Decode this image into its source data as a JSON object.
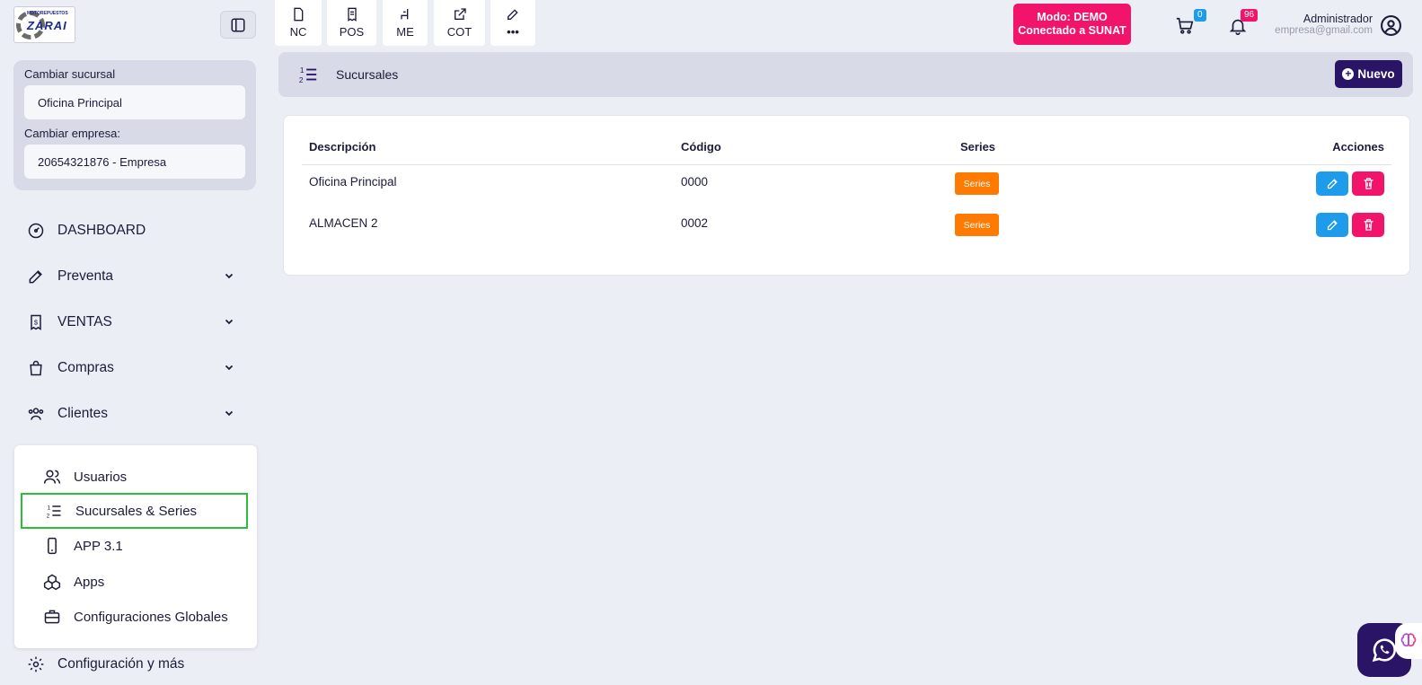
{
  "logo": {
    "top_text": "MOTOREPUESTOS",
    "brand": "ZARAI"
  },
  "branch_card": {
    "branch_label": "Cambiar sucursal",
    "branch_value": "Oficina Principal",
    "company_label": "Cambiar empresa:",
    "company_value": "20654321876 - Empresa"
  },
  "sidebar": {
    "items": [
      {
        "label": "DASHBOARD",
        "icon": "gauge-icon",
        "has_children": false
      },
      {
        "label": "Preventa",
        "icon": "edit-icon",
        "has_children": true
      },
      {
        "label": "VENTAS",
        "icon": "receipt-icon",
        "has_children": true
      },
      {
        "label": "Compras",
        "icon": "shopping-bag-icon",
        "has_children": true
      },
      {
        "label": "Clientes",
        "icon": "users-icon",
        "has_children": true
      }
    ],
    "submenu": [
      {
        "label": "Usuarios",
        "icon": "users-icon"
      },
      {
        "label": "Sucursales & Series",
        "icon": "ordered-list-icon",
        "active": true
      },
      {
        "label": "APP 3.1",
        "icon": "smartphone-icon"
      },
      {
        "label": "Apps",
        "icon": "boxes-icon"
      },
      {
        "label": "Configuraciones Globales",
        "icon": "briefcase-icon"
      }
    ],
    "footer": {
      "label": "Configuración y más",
      "icon": "gear-icon"
    }
  },
  "quick_actions": [
    {
      "label": "NC",
      "icon": "document-icon"
    },
    {
      "label": "POS",
      "icon": "receipt-icon"
    },
    {
      "label": "ME",
      "icon": "chair-icon"
    },
    {
      "label": "COT",
      "icon": "external-link-icon"
    },
    {
      "label": "•••",
      "icon": "edit-icon"
    }
  ],
  "demo_badge": {
    "line1": "Modo: DEMO",
    "line2": "Conectado a SUNAT"
  },
  "cart": {
    "count": "0",
    "icon": "cart-icon"
  },
  "notifications": {
    "count": "96",
    "icon": "bell-icon"
  },
  "user": {
    "name": "Administrador",
    "email": "empresa@gmail.com",
    "icon": "user-circle-icon"
  },
  "breadcrumb": {
    "title": "Sucursales",
    "icon": "ordered-list-icon",
    "new_button": "Nuevo"
  },
  "table": {
    "headers": {
      "description": "Descripción",
      "code": "Código",
      "series": "Series",
      "actions": "Acciones"
    },
    "rows": [
      {
        "description": "Oficina Principal",
        "code": "0000",
        "series_button": "Series"
      },
      {
        "description": "ALMACEN 2",
        "code": "0002",
        "series_button": "Series"
      }
    ]
  },
  "colors": {
    "primary": "#2a1466",
    "pink": "#f2136b",
    "orange": "#ff7a00",
    "blue": "#1e9ceb",
    "active_outline": "#2ebd3a"
  }
}
